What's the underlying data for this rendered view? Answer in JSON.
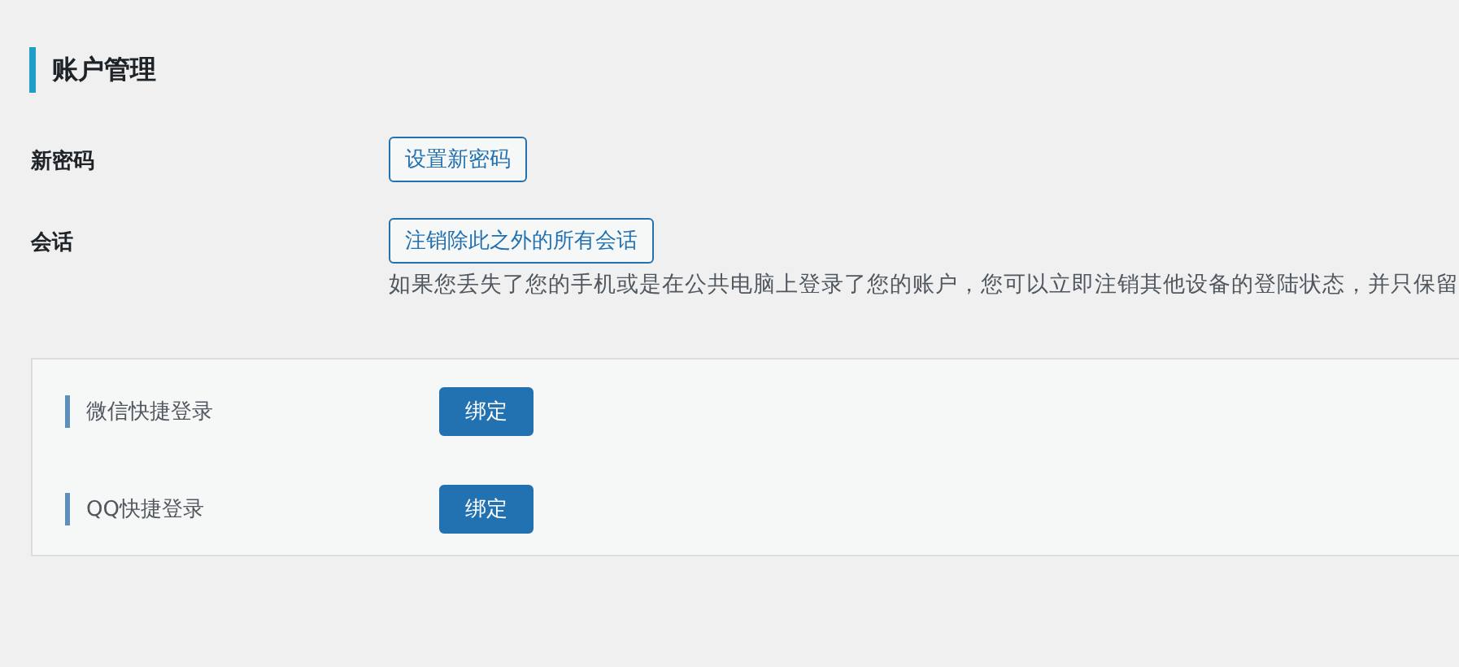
{
  "section": {
    "title": "账户管理"
  },
  "fields": [
    {
      "label": "新密码",
      "button": "设置新密码"
    },
    {
      "label": "会话",
      "button": "注销除此之外的所有会话",
      "description": "如果您丢失了您的手机或是在公共电脑上登录了您的账户，您可以立即注销其他设备的登陆状态，并只保留"
    }
  ],
  "social_logins": [
    {
      "label": "微信快捷登录",
      "button": "绑定"
    },
    {
      "label": "QQ快捷登录",
      "button": "绑定"
    }
  ]
}
